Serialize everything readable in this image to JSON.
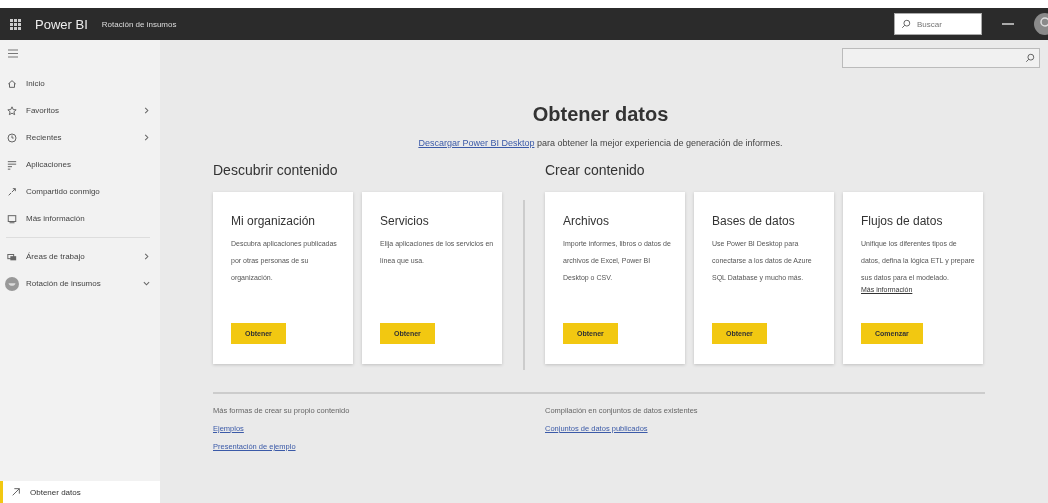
{
  "header": {
    "app_name": "Power BI",
    "workspace": "Rotación de insumos",
    "search": {
      "placeholder": "Buscar"
    }
  },
  "sidebar": {
    "items": [
      {
        "label": "Inicio",
        "kind": "home"
      },
      {
        "label": "Favoritos",
        "kind": "favorites",
        "expanded": false
      },
      {
        "label": "Recientes",
        "kind": "recent",
        "expanded": false
      },
      {
        "label": "Aplicaciones",
        "kind": "apps"
      },
      {
        "label": "Compartido conmigo",
        "kind": "shared"
      },
      {
        "label": "Más información",
        "kind": "learn"
      }
    ],
    "workspace_items": [
      {
        "label": "Áreas de trabajo",
        "kind": "workspaces",
        "expanded": false
      },
      {
        "label": "Rotación de insumos",
        "kind": "workspace",
        "expanded": true
      }
    ],
    "bottom_item": {
      "label": "Obtener datos",
      "selected": true
    }
  },
  "main": {
    "title": "Obtener datos",
    "intro": {
      "link": "Descargar Power BI Desktop",
      "text": "para obtener la mejor experiencia de generación de informes."
    },
    "sections": [
      {
        "heading": "Descubrir contenido",
        "cards": [
          {
            "title": "Mi organización",
            "text": "Descubra aplicaciones publicadas por otras personas de su organización.",
            "button": "Obtener"
          },
          {
            "title": "Servicios",
            "text": "Elija aplicaciones de los servicios en línea que usa.",
            "button": "Obtener"
          }
        ]
      },
      {
        "heading": "Crear contenido",
        "cards": [
          {
            "title": "Archivos",
            "text": "Importe informes, libros o datos de archivos de Excel, Power BI Desktop o CSV.",
            "button": "Obtener"
          },
          {
            "title": "Bases de datos",
            "text": "Use Power BI Desktop para conectarse a los datos de Azure SQL Database y mucho más.",
            "button": "Obtener"
          },
          {
            "title": "Flujos de datos",
            "text": "Unifique los diferentes tipos de datos, defina la lógica ETL y prepare sus datos para el modelado.",
            "link": "Más información",
            "button": "Comenzar"
          }
        ]
      }
    ],
    "footer": [
      {
        "heading": "Más formas de crear su propio contenido",
        "links": [
          "Ejemplos",
          "Presentación de ejemplo"
        ]
      },
      {
        "heading": "Compilación en conjuntos de datos existentes",
        "links": [
          "Conjuntos de datos publicados"
        ]
      }
    ]
  }
}
